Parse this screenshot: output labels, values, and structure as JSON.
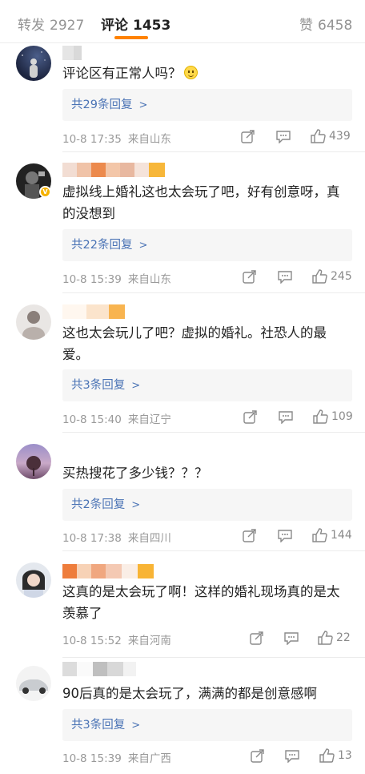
{
  "tabs": [
    {
      "label": "转发",
      "count": "2927"
    },
    {
      "label": "评论",
      "count": "1453"
    },
    {
      "label": "赞",
      "count": "6458"
    }
  ],
  "comments": [
    {
      "text": "评论区有正常人吗？",
      "emoji": "smile-emoji",
      "reply_label": "共29条回复",
      "time": "10-8 17:35",
      "location": "来自山东",
      "likes": "439"
    },
    {
      "text": "虚拟线上婚礼这也太会玩了吧，好有创意呀，真的没想到",
      "reply_label": "共22条回复",
      "time": "10-8 15:39",
      "location": "来自山东",
      "likes": "245"
    },
    {
      "text": "这也太会玩儿了吧？虚拟的婚礼。社恐人的最爱。",
      "reply_label": "共3条回复",
      "time": "10-8 15:40",
      "location": "来自辽宁",
      "likes": "109"
    },
    {
      "text": "买热搜花了多少钱？？？",
      "reply_label": "共2条回复",
      "time": "10-8 17:38",
      "location": "来自四川",
      "likes": "144"
    },
    {
      "text": "这真的是太会玩了啊！这样的婚礼现场真的是太羡慕了",
      "reply_label": "",
      "time": "10-8 15:52",
      "location": "来自河南",
      "likes": "22"
    },
    {
      "text": "90后真的是太会玩了，满满的都是创意感啊",
      "reply_label": "共3条回复",
      "time": "10-8 15:39",
      "location": "来自广西",
      "likes": "13"
    }
  ],
  "icons": {
    "share": "share-icon",
    "comment": "comment-icon",
    "like": "thumbs-up-icon",
    "chevron": "chevron-right-icon",
    "verified": "verified-badge-icon"
  },
  "colors": {
    "accent": "#ff8200",
    "link": "#4a73b5",
    "meta": "#999999",
    "reply_bg": "#f6f6f6"
  }
}
